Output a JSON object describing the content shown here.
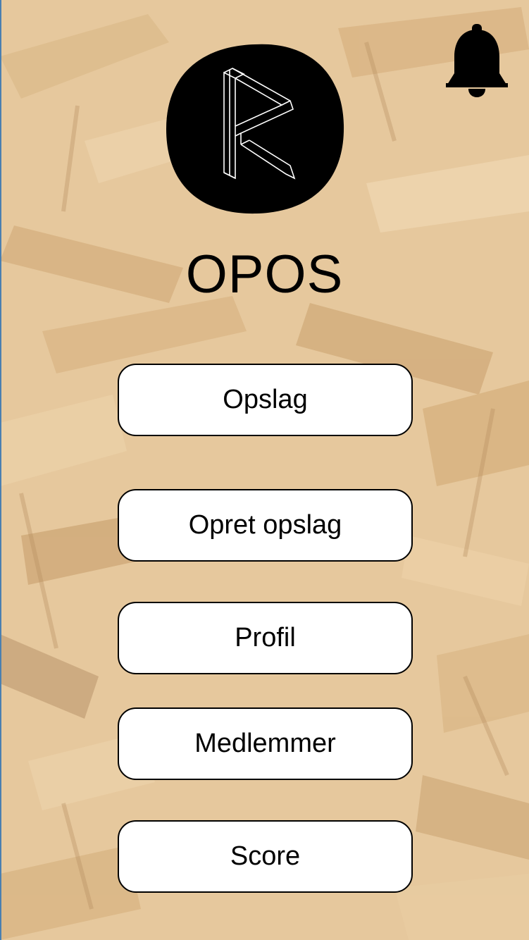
{
  "app": {
    "title": "OPOS",
    "logo_icon": "r-monogram-logo",
    "notification_icon": "bell-icon"
  },
  "colors": {
    "background": "#e6c89d",
    "button_bg": "#ffffff",
    "text": "#000000",
    "logo_bg": "#000000"
  },
  "menu": {
    "items": [
      {
        "label": "Opslag"
      },
      {
        "label": "Opret opslag"
      },
      {
        "label": "Profil"
      },
      {
        "label": "Medlemmer"
      },
      {
        "label": "Score"
      }
    ]
  }
}
